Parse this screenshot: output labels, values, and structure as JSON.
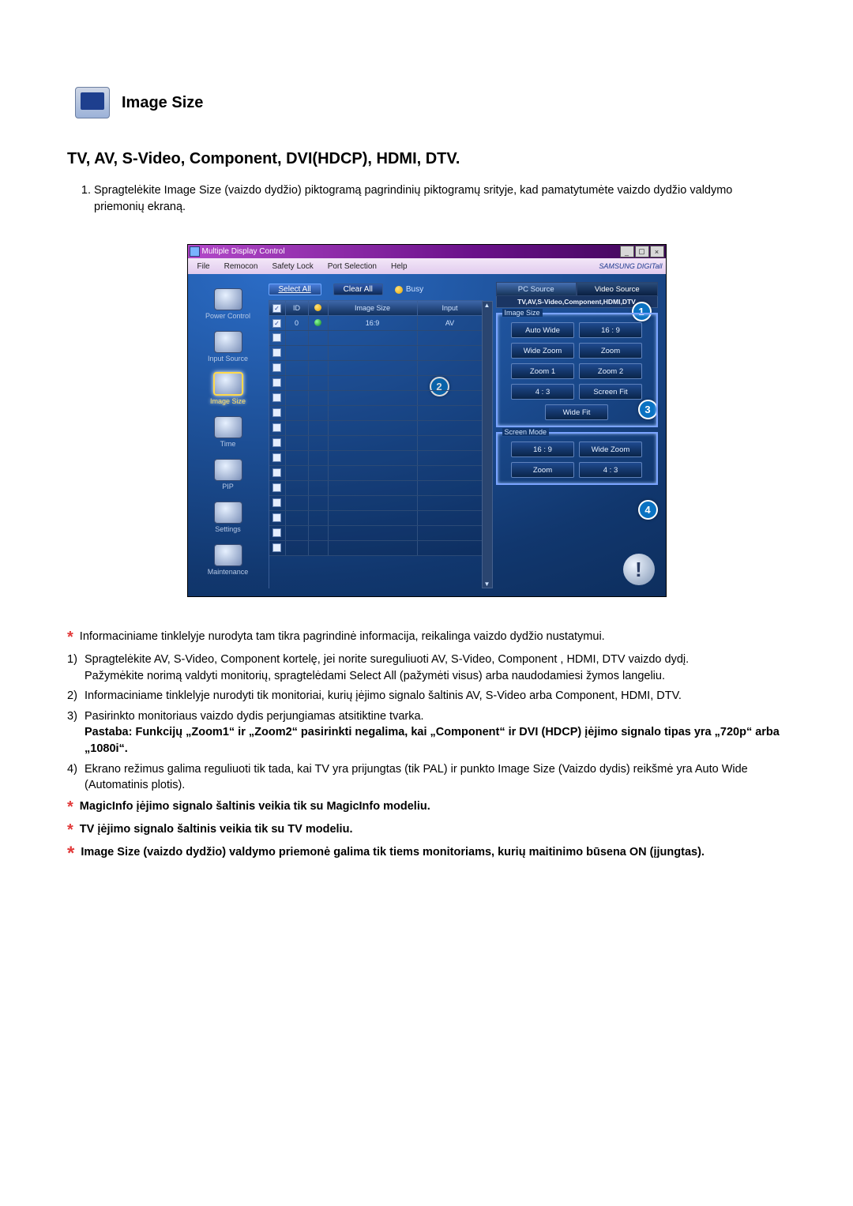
{
  "section": {
    "title": "Image Size"
  },
  "subhead": "TV, AV, S-Video, Component, DVI(HDCP), HDMI, DTV.",
  "intro_item": "Spragtelėkite Image Size (vaizdo dydžio) piktogramą pagrindinių piktogramų srityje, kad pamatytumėte vaizdo dydžio valdymo priemonių ekraną.",
  "window": {
    "title": "Multiple Display Control",
    "menu": [
      "File",
      "Remocon",
      "Safety Lock",
      "Port Selection",
      "Help"
    ],
    "brand": "SAMSUNG DIGITall",
    "sidebar": [
      "Power Control",
      "Input Source",
      "Image Size",
      "Time",
      "PIP",
      "Settings",
      "Maintenance"
    ],
    "top_buttons": {
      "select_all": "Select All",
      "clear_all": "Clear All"
    },
    "busy": "Busy",
    "columns": {
      "chk": "",
      "id": "ID",
      "status": "",
      "image_size": "Image Size",
      "input": "Input"
    },
    "row": {
      "id": "0",
      "image_size": "16:9",
      "input": "AV"
    },
    "tabs": {
      "pc": "PC Source",
      "video": "Video Source"
    },
    "source_strip": "TV,AV,S-Video,Component,HDMI,DTV",
    "image_size_group": {
      "label": "Image Size",
      "buttons": [
        "Auto Wide",
        "16 : 9",
        "Wide Zoom",
        "Zoom",
        "Zoom 1",
        "Zoom 2",
        "4 : 3",
        "Screen Fit",
        "Wide Fit"
      ]
    },
    "screen_mode_group": {
      "label": "Screen Mode",
      "buttons": [
        "16 : 9",
        "Wide Zoom",
        "Zoom",
        "4 : 3"
      ]
    },
    "callouts": [
      "1",
      "2",
      "3",
      "4"
    ]
  },
  "notes": {
    "star1": "Informaciniame tinklelyje nurodyta tam tikra pagrindinė informacija, reikalinga vaizdo dydžio nustatymui.",
    "items": [
      {
        "n": "1)",
        "text": "Spragtelėkite AV, S-Video, Component kortelę, jei norite sureguliuoti AV, S-Video, Component , HDMI, DTV vaizdo dydį.",
        "text2": "Pažymėkite norimą valdyti monitorių, spragtelėdami Select All (pažymėti visus) arba naudodamiesi žymos langeliu."
      },
      {
        "n": "2)",
        "text": "Informaciniame tinklelyje nurodyti tik monitoriai, kurių įėjimo signalo šaltinis AV, S-Video arba Component, HDMI, DTV."
      },
      {
        "n": "3)",
        "text": "Pasirinkto monitoriaus vaizdo dydis perjungiamas atsitiktine tvarka.",
        "note": "Pastaba: Funkcijų „Zoom1“ ir „Zoom2“ pasirinkti negalima, kai „Component“ ir DVI (HDCP) įėjimo signalo tipas yra „720p“ arba „1080i“."
      },
      {
        "n": "4)",
        "text": "Ekrano režimus galima reguliuoti tik tada, kai TV yra prijungtas (tik PAL) ir punkto Image Size (Vaizdo dydis) reikšmė yra Auto Wide (Automatinis plotis)."
      }
    ],
    "star2": "MagicInfo įėjimo signalo šaltinis veikia tik su MagicInfo modeliu.",
    "star3": "TV įėjimo signalo šaltinis veikia tik su TV modeliu.",
    "star4": "Image Size (vaizdo dydžio) valdymo priemonė galima tik tiems monitoriams, kurių maitinimo būsena ON (įjungtas)."
  }
}
